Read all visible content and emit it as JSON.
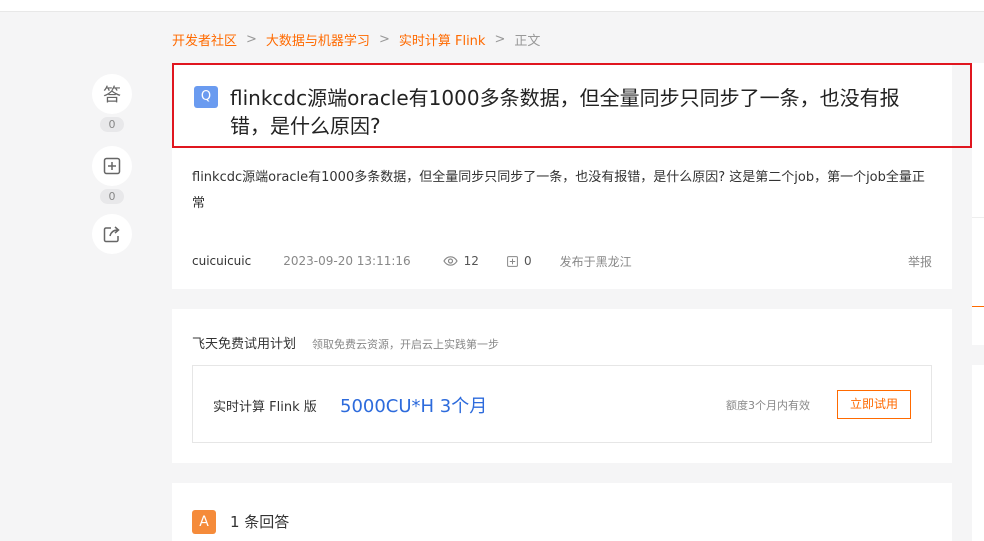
{
  "breadcrumb": {
    "items": [
      "开发者社区",
      "大数据与机器学习",
      "实时计算 Flink"
    ],
    "separator": ">",
    "current": "正文"
  },
  "side_actions": {
    "answer": {
      "icon": "answer-icon",
      "glyph": "答",
      "count": "0"
    },
    "follow": {
      "icon": "add-box-icon",
      "count": "0"
    },
    "share": {
      "icon": "share-icon"
    }
  },
  "question": {
    "badge": "Q",
    "title": "flinkcdc源端oracle有1000多条数据，但全量同步只同步了一条，也没有报错，是什么原因?",
    "body": "flinkcdc源端oracle有1000多条数据，但全量同步只同步了一条，也没有报错，是什么原因? 这是第二个job，第一个job全量正常",
    "author": "cuicuicuic",
    "time": "2023-09-20 13:11:16",
    "views": "12",
    "follows": "0",
    "location": "发布于黑龙江",
    "report": "举报"
  },
  "trial": {
    "title": "飞天免费试用计划",
    "subtitle": "领取免费云资源，开启云上实践第一步",
    "product": "实时计算 Flink 版",
    "quota": "5000CU*H 3个月",
    "validity": "额度3个月内有效",
    "button": "立即试用"
  },
  "answers": {
    "badge": "A",
    "count_label": "1 条回答"
  },
  "colors": {
    "accent": "#ff6a00",
    "highlight_border": "#e0161f",
    "q_badge": "#6a9bf0",
    "a_badge": "#f58b3a",
    "link_blue": "#2d6bdc"
  }
}
